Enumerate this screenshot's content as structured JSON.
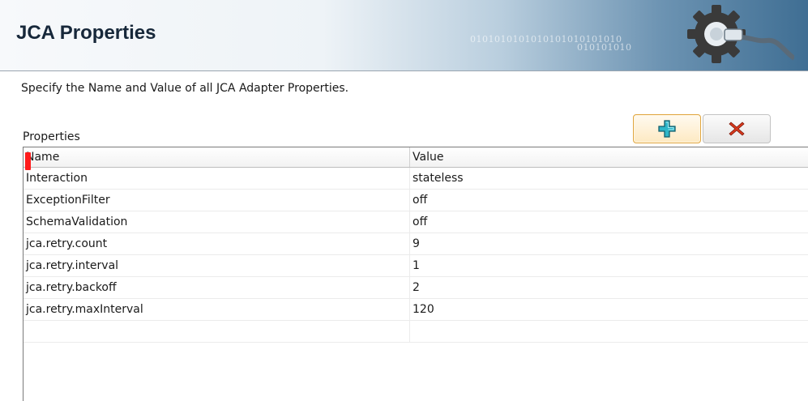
{
  "header": {
    "title": "JCA Properties",
    "binary_top": "0101010101010101010101010",
    "binary_bottom": "010101010"
  },
  "description": "Specify the Name and Value of all JCA Adapter Properties.",
  "properties": {
    "label": "Properties",
    "add_icon": "plus-icon",
    "delete_icon": "x-icon",
    "columns": [
      "Name",
      "Value"
    ],
    "rows": [
      {
        "name": "Interaction",
        "value": "stateless"
      },
      {
        "name": "ExceptionFilter",
        "value": "off"
      },
      {
        "name": "SchemaValidation",
        "value": "off"
      },
      {
        "name": "jca.retry.count",
        "value": "9"
      },
      {
        "name": "jca.retry.interval",
        "value": "1"
      },
      {
        "name": "jca.retry.backoff",
        "value": "2"
      },
      {
        "name": "jca.retry.maxInterval",
        "value": "120"
      },
      {
        "name": "",
        "value": ""
      }
    ]
  },
  "colors": {
    "add_icon": "#2fb6c8",
    "delete_icon": "#d93a1e",
    "cursor_mark": "#ff1c1c"
  }
}
